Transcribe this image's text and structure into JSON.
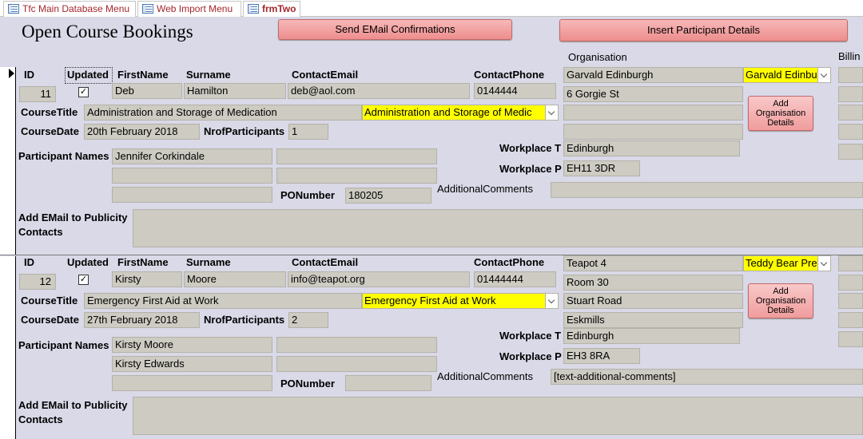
{
  "tabs": [
    {
      "label": "Tfc Main Database Menu",
      "active": false
    },
    {
      "label": "Web Import Menu",
      "active": false
    },
    {
      "label": "frmTwo",
      "active": true
    }
  ],
  "header": {
    "title": "Open Course Bookings",
    "send_email_label": "Send EMail Confirmations",
    "insert_participant_label": "Insert  Participant Details",
    "organisation_label": "Organisation",
    "billing_label": "Billin"
  },
  "labels": {
    "id": "ID",
    "updated": "Updated",
    "firstname": "FirstName",
    "surname": "Surname",
    "contact_email": "ContactEmail",
    "contact_phone": "ContactPhone",
    "course_title": "CourseTitle",
    "course_date": "CourseDate",
    "nrof_participants": "NrofParticipants",
    "participant_names": "Participant Names",
    "workplace_t": "Workplace T",
    "workplace_p": "Workplace P",
    "po_number": "PONumber",
    "additional_comments": "AdditionalComments",
    "add_email_publicity": "Add EMail to Publicity Contacts",
    "add_org_details": "Add Organisation Details"
  },
  "records": [
    {
      "id": "11",
      "updated": true,
      "first_name": "Deb",
      "surname": "Hamilton",
      "contact_email": "deb@aol.com",
      "contact_phone": "0144444",
      "course_title": "Administration and Storage of Medication",
      "course_title_combo": "Administration and Storage of Medic",
      "course_date": "20th February 2018",
      "nrof_participants": "1",
      "participants": [
        "Jennifer Corkindale",
        "",
        "",
        "",
        ""
      ],
      "po_number": "180205",
      "additional_comments": "",
      "organisation": "Garvald Edinburgh",
      "organisation_combo": "Garvald Edinbu",
      "address": [
        "6 Gorgie St",
        "",
        ""
      ],
      "workplace_town": "Edinburgh",
      "workplace_postcode": "EH11 3DR",
      "publicity": ""
    },
    {
      "id": "12",
      "updated": true,
      "first_name": "Kirsty",
      "surname": "Moore",
      "contact_email": "info@teapot.org",
      "contact_phone": "01444444",
      "course_title": "Emergency First Aid at Work",
      "course_title_combo": "Emergency First Aid at Work",
      "course_date": "27th February 2018",
      "nrof_participants": "2",
      "participants": [
        "Kirsty Moore",
        "",
        "Kirsty Edwards",
        "",
        ""
      ],
      "po_number": "",
      "additional_comments": "[text-additional-comments]",
      "organisation": "Teapot 4",
      "organisation_combo": "Teddy Bear Pre",
      "address": [
        "Room 30",
        "Stuart Road",
        "Eskmills"
      ],
      "workplace_town": "Edinburgh",
      "workplace_postcode": "EH3 8RA",
      "publicity": ""
    }
  ]
}
